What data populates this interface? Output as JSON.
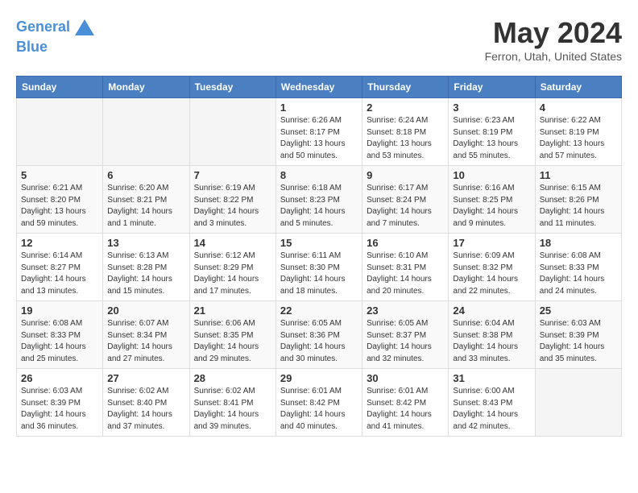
{
  "header": {
    "logo_line1": "General",
    "logo_line2": "Blue",
    "month_title": "May 2024",
    "location": "Ferron, Utah, United States"
  },
  "days_of_week": [
    "Sunday",
    "Monday",
    "Tuesday",
    "Wednesday",
    "Thursday",
    "Friday",
    "Saturday"
  ],
  "weeks": [
    [
      {
        "day": "",
        "sunrise": "",
        "sunset": "",
        "daylight": ""
      },
      {
        "day": "",
        "sunrise": "",
        "sunset": "",
        "daylight": ""
      },
      {
        "day": "",
        "sunrise": "",
        "sunset": "",
        "daylight": ""
      },
      {
        "day": "1",
        "sunrise": "Sunrise: 6:26 AM",
        "sunset": "Sunset: 8:17 PM",
        "daylight": "Daylight: 13 hours and 50 minutes."
      },
      {
        "day": "2",
        "sunrise": "Sunrise: 6:24 AM",
        "sunset": "Sunset: 8:18 PM",
        "daylight": "Daylight: 13 hours and 53 minutes."
      },
      {
        "day": "3",
        "sunrise": "Sunrise: 6:23 AM",
        "sunset": "Sunset: 8:19 PM",
        "daylight": "Daylight: 13 hours and 55 minutes."
      },
      {
        "day": "4",
        "sunrise": "Sunrise: 6:22 AM",
        "sunset": "Sunset: 8:19 PM",
        "daylight": "Daylight: 13 hours and 57 minutes."
      }
    ],
    [
      {
        "day": "5",
        "sunrise": "Sunrise: 6:21 AM",
        "sunset": "Sunset: 8:20 PM",
        "daylight": "Daylight: 13 hours and 59 minutes."
      },
      {
        "day": "6",
        "sunrise": "Sunrise: 6:20 AM",
        "sunset": "Sunset: 8:21 PM",
        "daylight": "Daylight: 14 hours and 1 minute."
      },
      {
        "day": "7",
        "sunrise": "Sunrise: 6:19 AM",
        "sunset": "Sunset: 8:22 PM",
        "daylight": "Daylight: 14 hours and 3 minutes."
      },
      {
        "day": "8",
        "sunrise": "Sunrise: 6:18 AM",
        "sunset": "Sunset: 8:23 PM",
        "daylight": "Daylight: 14 hours and 5 minutes."
      },
      {
        "day": "9",
        "sunrise": "Sunrise: 6:17 AM",
        "sunset": "Sunset: 8:24 PM",
        "daylight": "Daylight: 14 hours and 7 minutes."
      },
      {
        "day": "10",
        "sunrise": "Sunrise: 6:16 AM",
        "sunset": "Sunset: 8:25 PM",
        "daylight": "Daylight: 14 hours and 9 minutes."
      },
      {
        "day": "11",
        "sunrise": "Sunrise: 6:15 AM",
        "sunset": "Sunset: 8:26 PM",
        "daylight": "Daylight: 14 hours and 11 minutes."
      }
    ],
    [
      {
        "day": "12",
        "sunrise": "Sunrise: 6:14 AM",
        "sunset": "Sunset: 8:27 PM",
        "daylight": "Daylight: 14 hours and 13 minutes."
      },
      {
        "day": "13",
        "sunrise": "Sunrise: 6:13 AM",
        "sunset": "Sunset: 8:28 PM",
        "daylight": "Daylight: 14 hours and 15 minutes."
      },
      {
        "day": "14",
        "sunrise": "Sunrise: 6:12 AM",
        "sunset": "Sunset: 8:29 PM",
        "daylight": "Daylight: 14 hours and 17 minutes."
      },
      {
        "day": "15",
        "sunrise": "Sunrise: 6:11 AM",
        "sunset": "Sunset: 8:30 PM",
        "daylight": "Daylight: 14 hours and 18 minutes."
      },
      {
        "day": "16",
        "sunrise": "Sunrise: 6:10 AM",
        "sunset": "Sunset: 8:31 PM",
        "daylight": "Daylight: 14 hours and 20 minutes."
      },
      {
        "day": "17",
        "sunrise": "Sunrise: 6:09 AM",
        "sunset": "Sunset: 8:32 PM",
        "daylight": "Daylight: 14 hours and 22 minutes."
      },
      {
        "day": "18",
        "sunrise": "Sunrise: 6:08 AM",
        "sunset": "Sunset: 8:33 PM",
        "daylight": "Daylight: 14 hours and 24 minutes."
      }
    ],
    [
      {
        "day": "19",
        "sunrise": "Sunrise: 6:08 AM",
        "sunset": "Sunset: 8:33 PM",
        "daylight": "Daylight: 14 hours and 25 minutes."
      },
      {
        "day": "20",
        "sunrise": "Sunrise: 6:07 AM",
        "sunset": "Sunset: 8:34 PM",
        "daylight": "Daylight: 14 hours and 27 minutes."
      },
      {
        "day": "21",
        "sunrise": "Sunrise: 6:06 AM",
        "sunset": "Sunset: 8:35 PM",
        "daylight": "Daylight: 14 hours and 29 minutes."
      },
      {
        "day": "22",
        "sunrise": "Sunrise: 6:05 AM",
        "sunset": "Sunset: 8:36 PM",
        "daylight": "Daylight: 14 hours and 30 minutes."
      },
      {
        "day": "23",
        "sunrise": "Sunrise: 6:05 AM",
        "sunset": "Sunset: 8:37 PM",
        "daylight": "Daylight: 14 hours and 32 minutes."
      },
      {
        "day": "24",
        "sunrise": "Sunrise: 6:04 AM",
        "sunset": "Sunset: 8:38 PM",
        "daylight": "Daylight: 14 hours and 33 minutes."
      },
      {
        "day": "25",
        "sunrise": "Sunrise: 6:03 AM",
        "sunset": "Sunset: 8:39 PM",
        "daylight": "Daylight: 14 hours and 35 minutes."
      }
    ],
    [
      {
        "day": "26",
        "sunrise": "Sunrise: 6:03 AM",
        "sunset": "Sunset: 8:39 PM",
        "daylight": "Daylight: 14 hours and 36 minutes."
      },
      {
        "day": "27",
        "sunrise": "Sunrise: 6:02 AM",
        "sunset": "Sunset: 8:40 PM",
        "daylight": "Daylight: 14 hours and 37 minutes."
      },
      {
        "day": "28",
        "sunrise": "Sunrise: 6:02 AM",
        "sunset": "Sunset: 8:41 PM",
        "daylight": "Daylight: 14 hours and 39 minutes."
      },
      {
        "day": "29",
        "sunrise": "Sunrise: 6:01 AM",
        "sunset": "Sunset: 8:42 PM",
        "daylight": "Daylight: 14 hours and 40 minutes."
      },
      {
        "day": "30",
        "sunrise": "Sunrise: 6:01 AM",
        "sunset": "Sunset: 8:42 PM",
        "daylight": "Daylight: 14 hours and 41 minutes."
      },
      {
        "day": "31",
        "sunrise": "Sunrise: 6:00 AM",
        "sunset": "Sunset: 8:43 PM",
        "daylight": "Daylight: 14 hours and 42 minutes."
      },
      {
        "day": "",
        "sunrise": "",
        "sunset": "",
        "daylight": ""
      }
    ]
  ]
}
